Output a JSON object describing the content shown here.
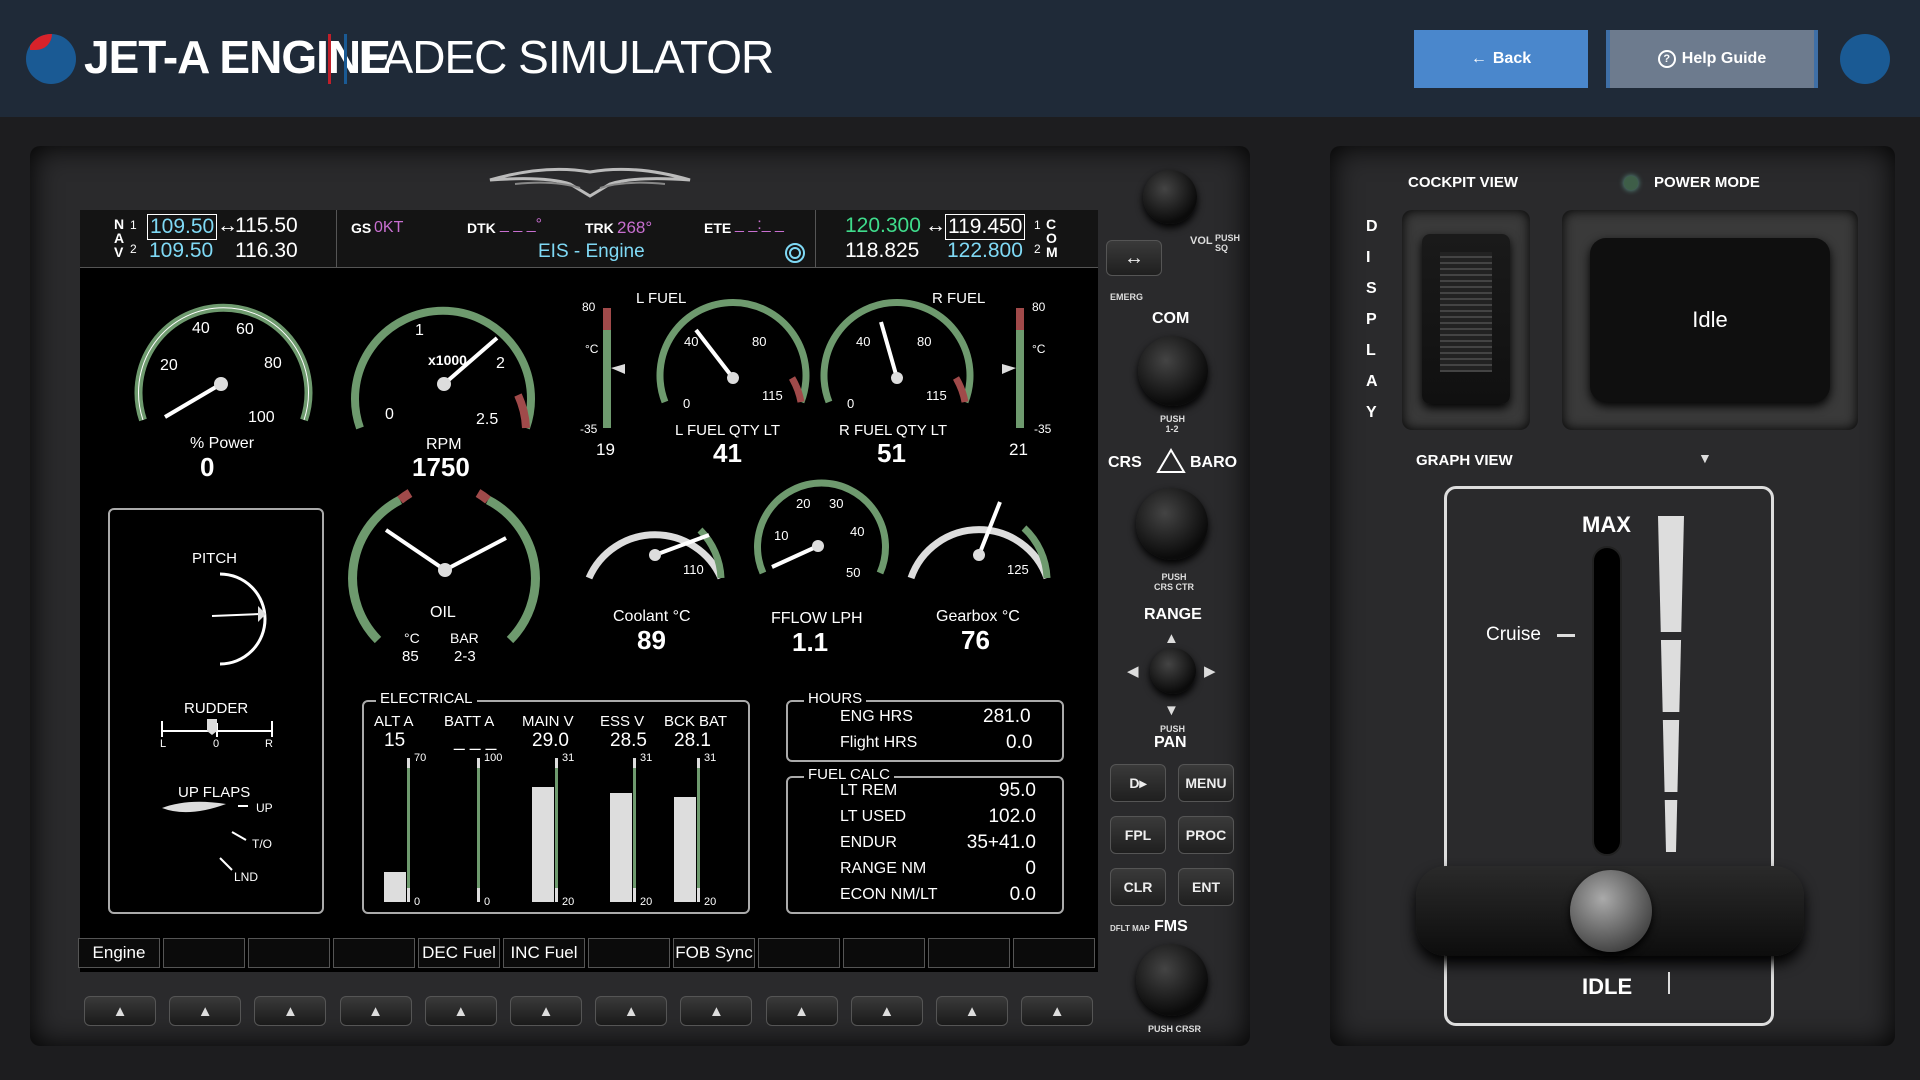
{
  "header": {
    "title_main": "JET-A ENGINE",
    "title_sub": "FADEC SIMULATOR",
    "back_label": "Back",
    "help_label": "Help Guide"
  },
  "nav": {
    "n_label": "N",
    "a_label": "A",
    "v_label": "V",
    "nav1_num": "1",
    "nav2_num": "2",
    "nav1_active": "109.50",
    "nav1_standby": "115.50",
    "nav2_active": "109.50",
    "nav2_standby": "116.30",
    "swap": "↔",
    "gs_label": "GS",
    "gs_value": "0KT",
    "dtk_label": "DTK",
    "dtk_value": "_ _ _°",
    "trk_label": "TRK",
    "trk_value": "268°",
    "ete_label": "ETE",
    "ete_value": "_ _:_ _",
    "page_name": "EIS - Engine",
    "com1_active": "120.300",
    "com1_standby": "119.450",
    "com2_active": "118.825",
    "com2_standby": "122.800",
    "com1_num": "1",
    "com2_num": "2",
    "c_label": "C",
    "o_label": "O",
    "m_label": "M"
  },
  "gauges": {
    "power": {
      "label": "% Power",
      "value": "0",
      "ticks": [
        "20",
        "40",
        "60",
        "80",
        "100"
      ],
      "needle": 0
    },
    "rpm": {
      "label": "RPM",
      "value": "1750",
      "unit": "x1000",
      "ticks": [
        "0",
        "1",
        "2",
        "2.5"
      ],
      "needle": 1.75
    },
    "lfuel_temp": {
      "title": "",
      "value": "19",
      "top": "80",
      "bottom": "-35",
      "unit": "°C"
    },
    "rfuel_temp": {
      "title": "",
      "value": "21",
      "top": "80",
      "bottom": "-35",
      "unit": "°C"
    },
    "lfuel": {
      "title": "L FUEL",
      "label": "L FUEL QTY LT",
      "value": "41",
      "ticks": [
        "0",
        "40",
        "80",
        "115"
      ]
    },
    "rfuel": {
      "title": "R FUEL",
      "label": "R FUEL QTY LT",
      "value": "51",
      "ticks": [
        "0",
        "40",
        "80",
        "115"
      ]
    },
    "oil": {
      "label": "OIL",
      "temp_unit": "°C",
      "temp_value": "85",
      "press_unit": "BAR",
      "press_value": "2-3"
    },
    "coolant": {
      "label": "Coolant °C",
      "value": "89",
      "tick": "110"
    },
    "fflow": {
      "label": "FFLOW LPH",
      "value": "1.1",
      "ticks": [
        "10",
        "20",
        "30",
        "40",
        "50"
      ]
    },
    "gearbox": {
      "label": "Gearbox °C",
      "value": "76",
      "tick": "125"
    }
  },
  "trim": {
    "pitch_label": "PITCH",
    "rudder_label": "RUDDER",
    "rudder_l": "L",
    "rudder_0": "0",
    "rudder_r": "R",
    "flaps_label": "UP FLAPS",
    "flap_up": "UP",
    "flap_to": "T/O",
    "flap_lnd": "LND"
  },
  "electrical": {
    "title": "ELECTRICAL",
    "bars": [
      {
        "name": "ALT A",
        "value": "15",
        "max": "70",
        "min": "0",
        "fill": 0.21
      },
      {
        "name": "BATT A",
        "value": "_ _ _",
        "max": "100",
        "min": "0",
        "fill": 0
      },
      {
        "name": "MAIN V",
        "value": "29.0",
        "max": "31",
        "min": "20",
        "fill": 0.8
      },
      {
        "name": "ESS V",
        "value": "28.5",
        "max": "31",
        "min": "20",
        "fill": 0.76
      },
      {
        "name": "BCK BAT",
        "value": "28.1",
        "max": "31",
        "min": "20",
        "fill": 0.73
      }
    ]
  },
  "hours": {
    "title": "HOURS",
    "eng_label": "ENG HRS",
    "eng_value": "281.0",
    "flight_label": "Flight HRS",
    "flight_value": "0.0"
  },
  "fuelcalc": {
    "title": "FUEL CALC",
    "rows": [
      {
        "label": "LT REM",
        "value": "95.0"
      },
      {
        "label": "LT USED",
        "value": "102.0"
      },
      {
        "label": "ENDUR",
        "value": "35+41.0"
      },
      {
        "label": "RANGE NM",
        "value": "0"
      },
      {
        "label": "ECON NM/LT",
        "value": "0.0"
      }
    ]
  },
  "softkeys": [
    "Engine",
    "",
    "",
    "",
    "DEC Fuel",
    "INC Fuel",
    "",
    "FOB Sync",
    "",
    "",
    "",
    ""
  ],
  "controls": {
    "vol_label": "VOL",
    "push_sq": "PUSH SQ",
    "emerg": "EMERG",
    "com_label": "COM",
    "push_12": "PUSH 1-2",
    "crs_label": "CRS",
    "baro_label": "BARO",
    "push_crs_ctr": "PUSH CRS CTR",
    "range_label": "RANGE",
    "pan_label": "PAN",
    "push": "PUSH",
    "direct": "D▸",
    "menu": "MENU",
    "fpl": "FPL",
    "proc": "PROC",
    "clr": "CLR",
    "ent": "ENT",
    "dflt_map": "DFLT MAP",
    "fms_label": "FMS",
    "push_crsr": "PUSH CRSR"
  },
  "right_panel": {
    "cockpit_view": "COCKPIT VIEW",
    "power_mode": "POWER MODE",
    "display_letters": [
      "D",
      "I",
      "S",
      "P",
      "L",
      "A",
      "Y"
    ],
    "mode_value": "Idle",
    "graph_view": "GRAPH VIEW",
    "throttle_max": "MAX",
    "throttle_idle": "IDLE",
    "throttle_cruise": "Cruise",
    "throttle_position": 0.0
  },
  "colors": {
    "accent_blue": "#4a87cc",
    "help_grey": "#6d7b8e",
    "brand_red": "#c01f2a",
    "nav_cyan": "#7fd9f5",
    "magenta": "#c86fd0",
    "arc_green": "#6e9a6e",
    "arc_red": "#a04a4a"
  }
}
